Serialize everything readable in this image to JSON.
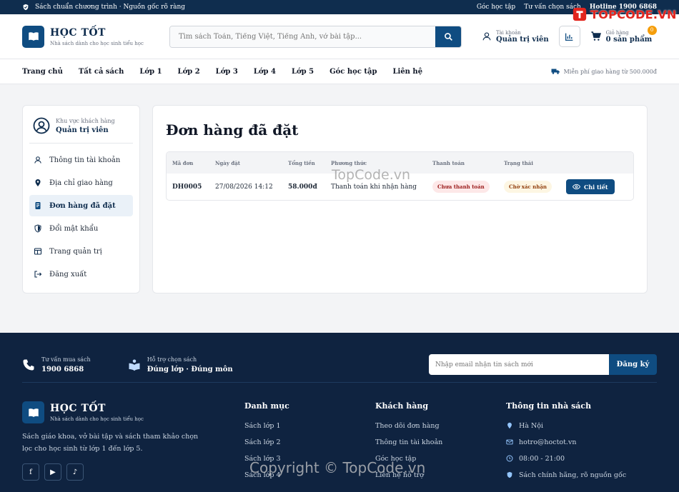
{
  "topbar": {
    "tagline": "Sách chuẩn chương trình · Nguồn gốc rõ ràng",
    "links": [
      "Góc học tập",
      "Tư vấn chọn sách"
    ],
    "hotline": "Hotline 1900 6868"
  },
  "brand": {
    "name": "HỌC TỐT",
    "slogan": "Nhà sách dành cho học sinh tiểu học"
  },
  "search": {
    "placeholder": "Tìm sách Toán, Tiếng Việt, Tiếng Anh, vở bài tập..."
  },
  "account": {
    "small": "Tài khoản",
    "name": "Quản trị viên"
  },
  "cart": {
    "small": "Giỏ hàng",
    "label": "0 sản phẩm",
    "count": "0"
  },
  "nav": {
    "items": [
      "Trang chủ",
      "Tất cả sách",
      "Lớp 1",
      "Lớp 2",
      "Lớp 3",
      "Lớp 4",
      "Lớp 5",
      "Góc học tập",
      "Liên hệ"
    ],
    "shipping": "Miễn phí giao hàng từ 500.000đ"
  },
  "sidebar": {
    "area": "Khu vực khách hàng",
    "user": "Quản trị viên",
    "items": [
      {
        "label": "Thông tin tài khoản",
        "icon": "user-icon"
      },
      {
        "label": "Địa chỉ giao hàng",
        "icon": "location-pin-icon"
      },
      {
        "label": "Đơn hàng đã đặt",
        "icon": "receipt-icon"
      },
      {
        "label": "Đổi mật khẩu",
        "icon": "shield-icon"
      },
      {
        "label": "Trang quản trị",
        "icon": "layout-icon"
      },
      {
        "label": "Đăng xuất",
        "icon": "logout-icon"
      }
    ],
    "active_index": 2
  },
  "orders": {
    "title": "Đơn hàng đã đặt",
    "columns": [
      "Mã đơn",
      "Ngày đặt",
      "Tổng tiền",
      "Phương thức",
      "Thanh toán",
      "Trạng thái",
      ""
    ],
    "rows": [
      {
        "id": "DH0005",
        "date": "27/08/2026 14:12",
        "total": "58.000đ",
        "method": "Thanh toán khi nhận hàng",
        "payment": "Chưa thanh toán",
        "status": "Chờ xác nhận",
        "action": "Chi tiết"
      }
    ]
  },
  "footer": {
    "contact1": {
      "small": "Tư vấn mua sách",
      "big": "1900 6868"
    },
    "contact2": {
      "small": "Hỗ trợ chọn sách",
      "big": "Đúng lớp · Đúng môn"
    },
    "newsletter": {
      "placeholder": "Nhập email nhận tin sách mới",
      "button": "Đăng ký"
    },
    "description": "Sách giáo khoa, vở bài tập và sách tham khảo chọn lọc cho học sinh từ lớp 1 đến lớp 5.",
    "socials": [
      "f",
      "▶",
      "♪"
    ],
    "categories": {
      "title": "Danh mục",
      "links": [
        "Sách lớp 1",
        "Sách lớp 2",
        "Sách lớp 3",
        "Sách lớp 4"
      ]
    },
    "customers": {
      "title": "Khách hàng",
      "links": [
        "Theo dõi đơn hàng",
        "Thông tin tài khoản",
        "Góc học tập",
        "Liên hệ hỗ trợ"
      ]
    },
    "store": {
      "title": "Thông tin nhà sách",
      "links": [
        "Hà Nội",
        "hotro@hoctot.vn",
        "08:00 - 21:00",
        "Sách chính hãng, rõ nguồn gốc"
      ]
    }
  },
  "watermarks": {
    "brand": "TOPCODE.VN",
    "mid": "TopCode.vn",
    "bottom": "Copyright © TopCode.vn"
  },
  "colors": {
    "primary": "#0f4c81",
    "dark": "#0f2340",
    "accent": "#f59e0b"
  }
}
